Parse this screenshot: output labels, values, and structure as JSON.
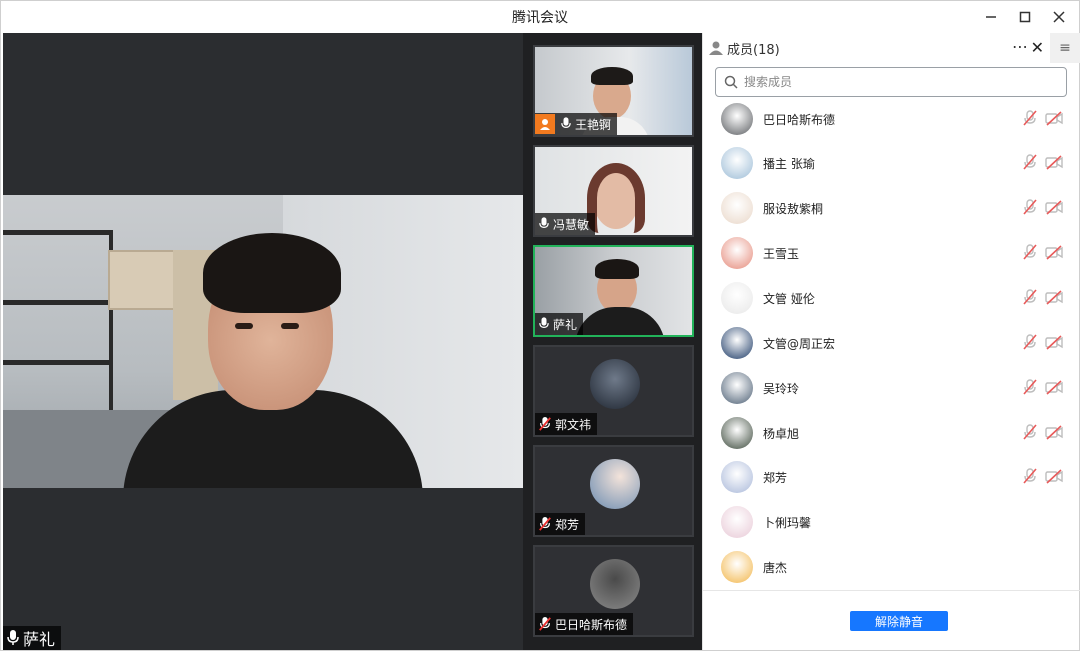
{
  "window": {
    "title": "腾讯会议"
  },
  "main_video": {
    "speaker_name": "萨礼"
  },
  "thumbnails": [
    {
      "name": "王艳锕",
      "host": true,
      "muted": false,
      "active": false
    },
    {
      "name": "冯慧敏",
      "host": false,
      "muted": false,
      "active": false
    },
    {
      "name": "萨礼",
      "host": false,
      "muted": false,
      "active": true
    },
    {
      "name": "郭文祎",
      "host": false,
      "muted": true,
      "active": false
    },
    {
      "name": "郑芳",
      "host": false,
      "muted": true,
      "active": false
    },
    {
      "name": "巴日哈斯布德",
      "host": false,
      "muted": true,
      "active": false
    }
  ],
  "panel": {
    "title": "成员(18)",
    "search_placeholder": "搜索成员",
    "unmute_label": "解除静音",
    "members": [
      {
        "name": "巴日哈斯布德",
        "mic_muted": true,
        "cam_off": true,
        "avatar_color": "#5a5d61"
      },
      {
        "name": "播主 张瑜",
        "mic_muted": true,
        "cam_off": true,
        "avatar_color": "#9cbcd6"
      },
      {
        "name": "服设敖紫桐",
        "mic_muted": true,
        "cam_off": true,
        "avatar_color": "#e9d7c8"
      },
      {
        "name": "王雪玉",
        "mic_muted": true,
        "cam_off": true,
        "avatar_color": "#e58a7a"
      },
      {
        "name": "文管 娅伦",
        "mic_muted": true,
        "cam_off": true,
        "avatar_color": "#e7e7e7"
      },
      {
        "name": "文管@周正宏",
        "mic_muted": true,
        "cam_off": true,
        "avatar_color": "#1c3a66"
      },
      {
        "name": "吴玲玲",
        "mic_muted": true,
        "cam_off": true,
        "avatar_color": "#4b5e73"
      },
      {
        "name": "杨卓旭",
        "mic_muted": true,
        "cam_off": true,
        "avatar_color": "#3c4a3c"
      },
      {
        "name": "郑芳",
        "mic_muted": true,
        "cam_off": true,
        "avatar_color": "#a9b8d9"
      },
      {
        "name": "卜俐玛馨",
        "mic_muted": false,
        "cam_off": false,
        "avatar_color": "#e8c9d6"
      },
      {
        "name": "唐杰",
        "mic_muted": false,
        "cam_off": false,
        "avatar_color": "#f2b64a"
      }
    ]
  }
}
